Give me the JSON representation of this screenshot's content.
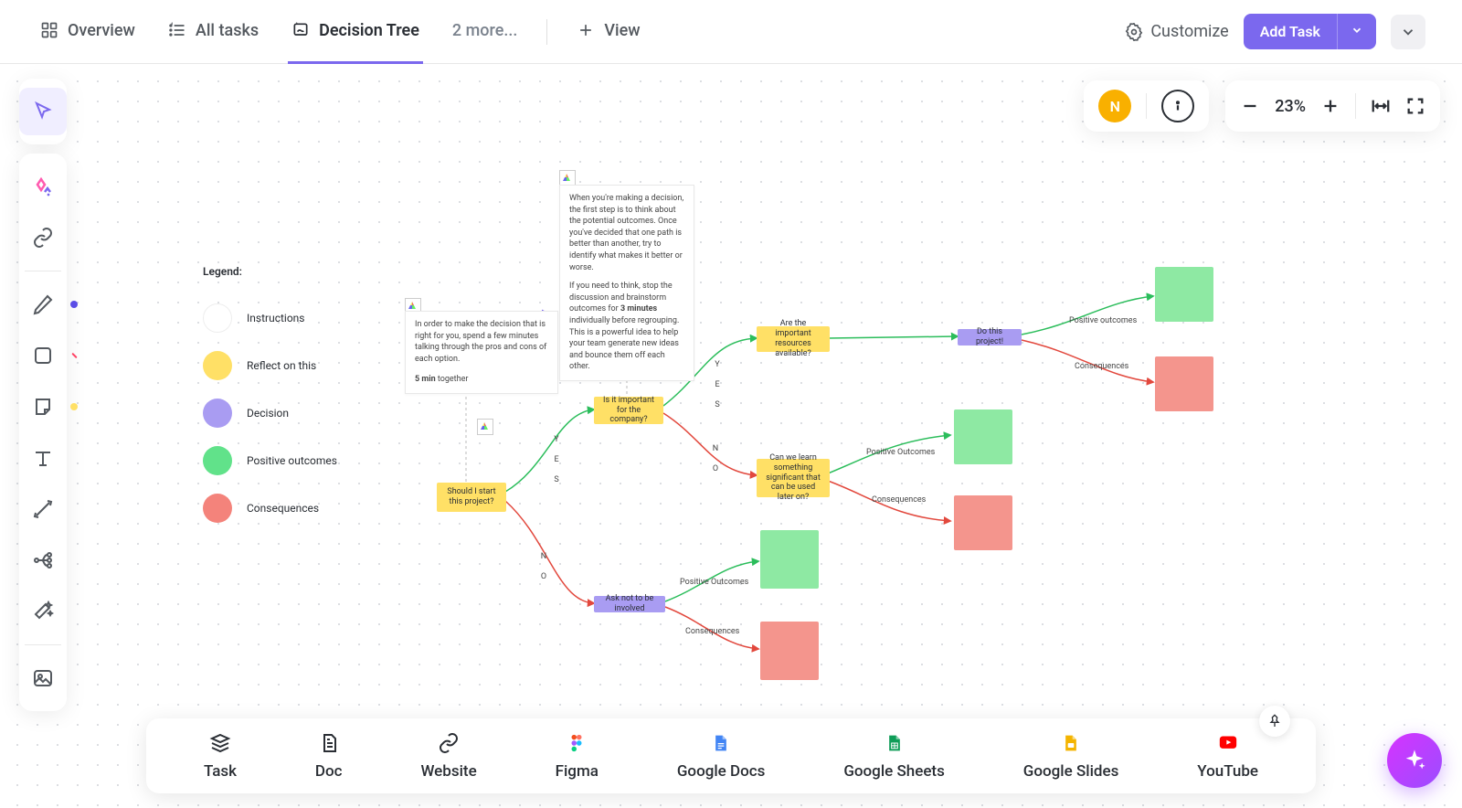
{
  "tabs": {
    "overview": "Overview",
    "all_tasks": "All tasks",
    "decision_tree": "Decision Tree",
    "more": "2 more...",
    "view": "View"
  },
  "customize": "Customize",
  "add_task": "Add Task",
  "avatar_initial": "N",
  "zoom": "23%",
  "legend": {
    "title": "Legend:",
    "items": [
      {
        "label": "Instructions",
        "color": "#ffffff",
        "border": "#eeeeee"
      },
      {
        "label": "Reflect on this",
        "color": "#ffe066"
      },
      {
        "label": "Decision",
        "color": "#a99cf2"
      },
      {
        "label": "Positive outcomes",
        "color": "#61e28a"
      },
      {
        "label": "Consequences",
        "color": "#f4837b"
      }
    ]
  },
  "notes": {
    "left": {
      "line1": "In order to make the decision that is right for you, spend a few minutes talking through the pros and cons of each option.",
      "line2_bold": "5 min",
      "line2_rest": " together"
    },
    "top": {
      "p1": "When you're making a decision, the first step is to think about the potential outcomes. Once you've decided that one path is better than another, try to identify what makes it better or worse.",
      "p2a": "If you need to think, stop the discussion and brainstorm outcomes for ",
      "p2b": "3 minutes",
      "p2c": " individually before regrouping. This is a powerful idea to help your team generate new ideas and bounce them off each other."
    }
  },
  "nodes": {
    "start": "Should I start this project?",
    "important": "Is it important for the company?",
    "resources": "Are the important resources available?",
    "learn": "Can we learn something significant that can be used later on?",
    "do_project": "Do this project!",
    "ask_not": "Ask not to be involved"
  },
  "edge_labels": {
    "yes": "Y E S",
    "no": "N O",
    "positive_outcomes": "Positive Outcomes",
    "positive_outcomes_lower": "Positive outcomes",
    "consequences": "Consequences"
  },
  "bottom_bar": {
    "task": "Task",
    "doc": "Doc",
    "website": "Website",
    "figma": "Figma",
    "gdocs": "Google Docs",
    "gsheets": "Google Sheets",
    "gslides": "Google Slides",
    "youtube": "YouTube"
  },
  "colors": {
    "accent": "#7b68ee",
    "yellow": "#ffe066",
    "purple_node": "#a99cf2",
    "green_node": "#8ee9a3",
    "red_node": "#f4958d",
    "avatar": "#f9b000"
  }
}
